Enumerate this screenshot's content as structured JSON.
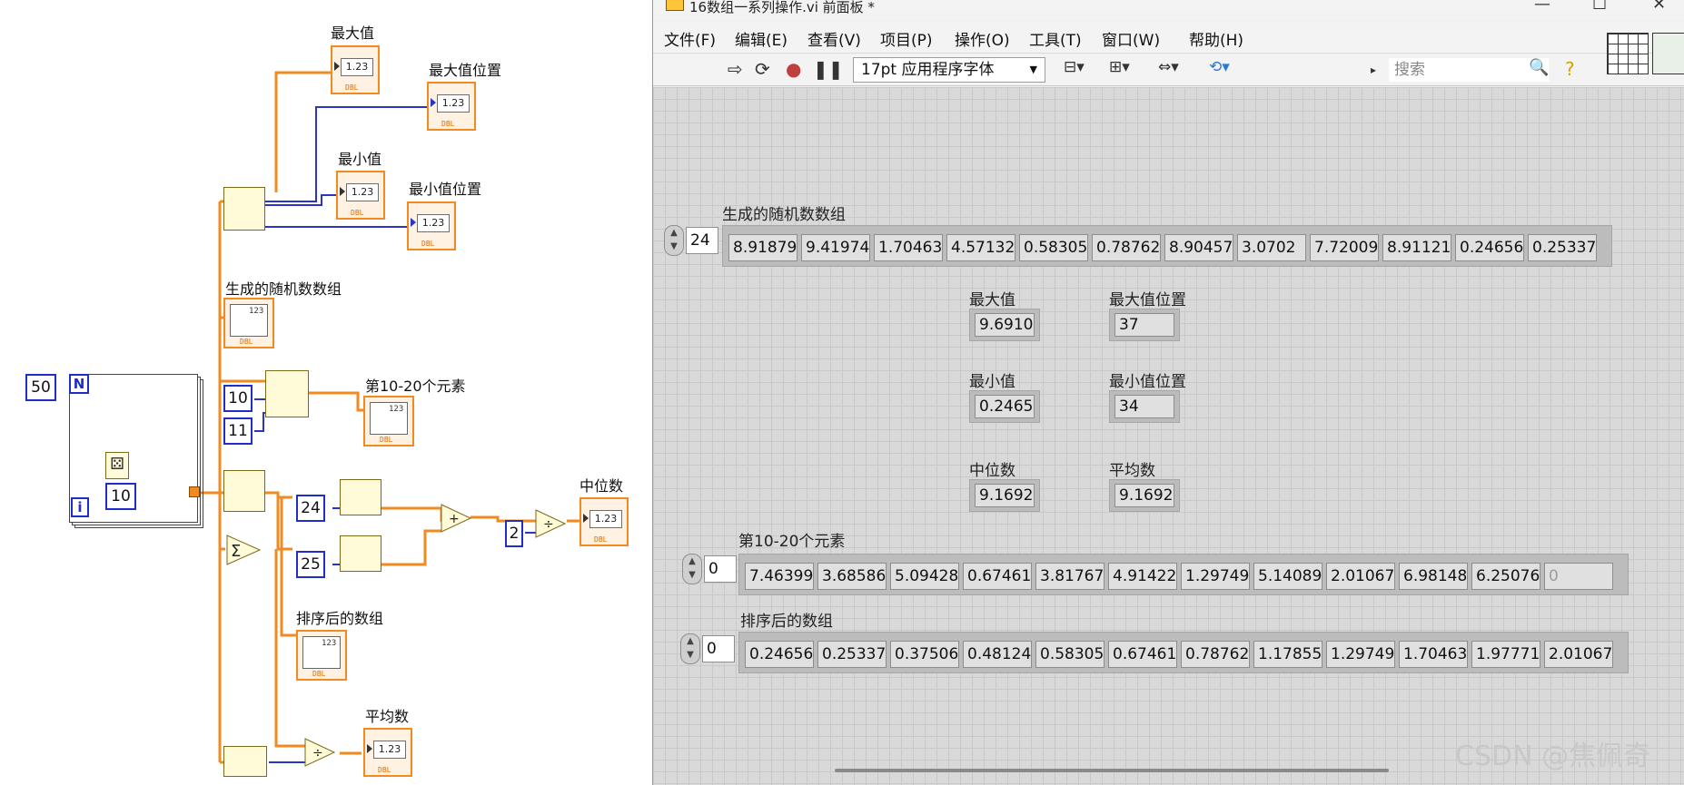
{
  "window_title": "16数组一系列操作.vi 前面板 *",
  "menu": [
    "文件(F)",
    "编辑(E)",
    "查看(V)",
    "项目(P)",
    "操作(O)",
    "工具(T)",
    "窗口(W)",
    "帮助(H)"
  ],
  "toolbar": {
    "font_select": "17pt 应用程序字体",
    "search_placeholder": "搜索"
  },
  "front_panel": {
    "random_array": {
      "label": "生成的随机数数组",
      "index": "24",
      "values": [
        "8.91879",
        "9.41974",
        "1.70463",
        "4.57132",
        "0.58305",
        "0.78762",
        "8.90457",
        "3.0702",
        "7.72009",
        "8.91121",
        "0.24656",
        "0.25337"
      ]
    },
    "max_value": {
      "label": "最大值",
      "value": "9.69102"
    },
    "max_index": {
      "label": "最大值位置",
      "value": "37"
    },
    "min_value": {
      "label": "最小值",
      "value": "0.24656"
    },
    "min_index": {
      "label": "最小值位置",
      "value": "34"
    },
    "median": {
      "label": "中位数",
      "value": "9.16926"
    },
    "mean": {
      "label": "平均数",
      "value": "9.16926"
    },
    "subset": {
      "label": "第10-20个元素",
      "index": "0",
      "values": [
        "7.46399",
        "3.68586",
        "5.09428",
        "0.67461",
        "3.81767",
        "4.91422",
        "1.29749",
        "5.14089",
        "2.01067",
        "6.98148",
        "6.25076"
      ],
      "empty_value": "0"
    },
    "sorted": {
      "label": "排序后的数组",
      "index": "0",
      "values": [
        "0.24656",
        "0.25337",
        "0.37506",
        "0.48124",
        "0.58305",
        "0.67461",
        "0.78762",
        "1.17855",
        "1.29749",
        "1.70463",
        "1.97771",
        "2.01067"
      ]
    }
  },
  "block_diagram": {
    "labels": {
      "max_value": "最大值",
      "max_index": "最大值位置",
      "min_value": "最小值",
      "min_index": "最小值位置",
      "random_array": "生成的随机数数组",
      "subset": "第10-20个元素",
      "median": "中位数",
      "sorted": "排序后的数组",
      "mean": "平均数"
    },
    "constants": {
      "loop_count": "50",
      "multiplier": "10",
      "start_index": "10",
      "length": "11",
      "idx_a": "24",
      "idx_b": "25",
      "divisor": "2"
    },
    "loop_n": "N",
    "loop_i": "i",
    "indicator_text": "1.23",
    "array_text": "123",
    "dtype": "DBL"
  },
  "watermark": "CSDN @焦佩奇"
}
